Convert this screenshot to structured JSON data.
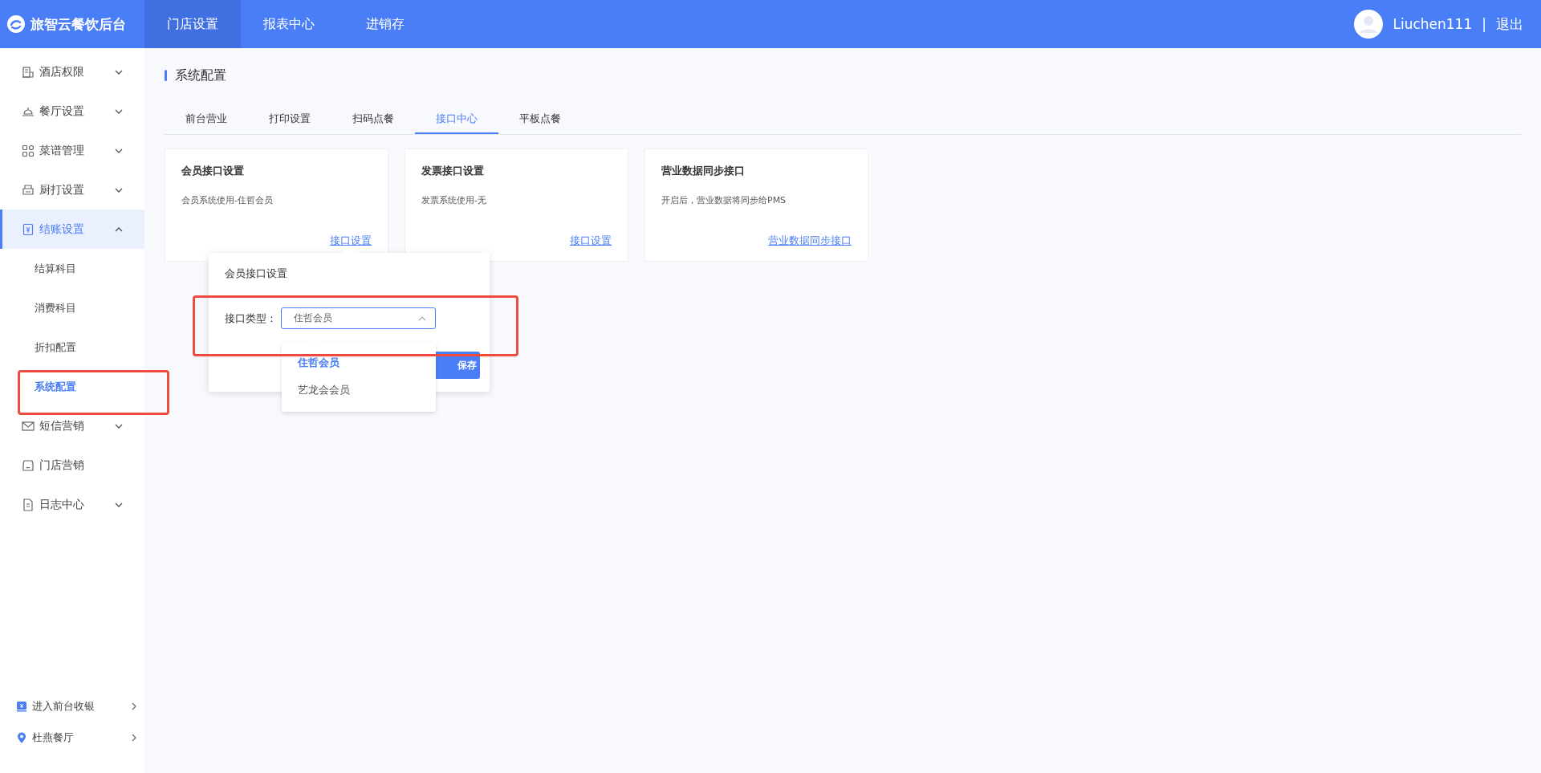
{
  "header": {
    "logo_text": "旅智云餐饮后台",
    "nav": [
      {
        "label": "门店设置",
        "selected": true
      },
      {
        "label": "报表中心",
        "selected": false
      },
      {
        "label": "进销存",
        "selected": false
      }
    ],
    "user": {
      "name": "Liuchen111",
      "separator": "|",
      "logout": "退出"
    }
  },
  "sidebar": {
    "items": [
      {
        "label": "酒店权限",
        "kind": "group",
        "expanded": false,
        "selected": false
      },
      {
        "label": "餐厅设置",
        "kind": "group",
        "expanded": false,
        "selected": false
      },
      {
        "label": "菜谱管理",
        "kind": "group",
        "expanded": false,
        "selected": false
      },
      {
        "label": "厨打设置",
        "kind": "group",
        "expanded": false,
        "selected": false
      },
      {
        "label": "结账设置",
        "kind": "group",
        "expanded": true,
        "selected": true,
        "children": [
          {
            "label": "结算科目",
            "selected": false
          },
          {
            "label": "消费科目",
            "selected": false
          },
          {
            "label": "折扣配置",
            "selected": false
          },
          {
            "label": "系统配置",
            "selected": true
          }
        ]
      },
      {
        "label": "短信营销",
        "kind": "group",
        "expanded": false,
        "selected": false
      },
      {
        "label": "门店营销",
        "kind": "link",
        "selected": false
      },
      {
        "label": "日志中心",
        "kind": "group",
        "expanded": false,
        "selected": false
      }
    ],
    "footer": [
      {
        "label": "进入前台收银"
      },
      {
        "label": "杜燕餐厅"
      }
    ]
  },
  "page": {
    "title": "系统配置",
    "tabs": [
      {
        "label": "前台营业",
        "selected": false
      },
      {
        "label": "打印设置",
        "selected": false
      },
      {
        "label": "扫码点餐",
        "selected": false
      },
      {
        "label": "接口中心",
        "selected": true
      },
      {
        "label": "平板点餐",
        "selected": false
      }
    ],
    "cards": [
      {
        "title": "会员接口设置",
        "description": "会员系统使用-住哲会员",
        "link": "接口设置"
      },
      {
        "title": "发票接口设置",
        "description": "发票系统使用-无",
        "link": "接口设置"
      },
      {
        "title": "营业数据同步接口",
        "description": "开启后，营业数据将同步给PMS",
        "link": "营业数据同步接口"
      }
    ],
    "popover": {
      "title": "会员接口设置",
      "field_label": "接口类型：",
      "select_value": "住哲会员",
      "expanded": true,
      "options": [
        {
          "label": "住哲会员",
          "selected": true
        },
        {
          "label": "艺龙会会员",
          "selected": false
        }
      ],
      "save_button": "保存"
    }
  }
}
